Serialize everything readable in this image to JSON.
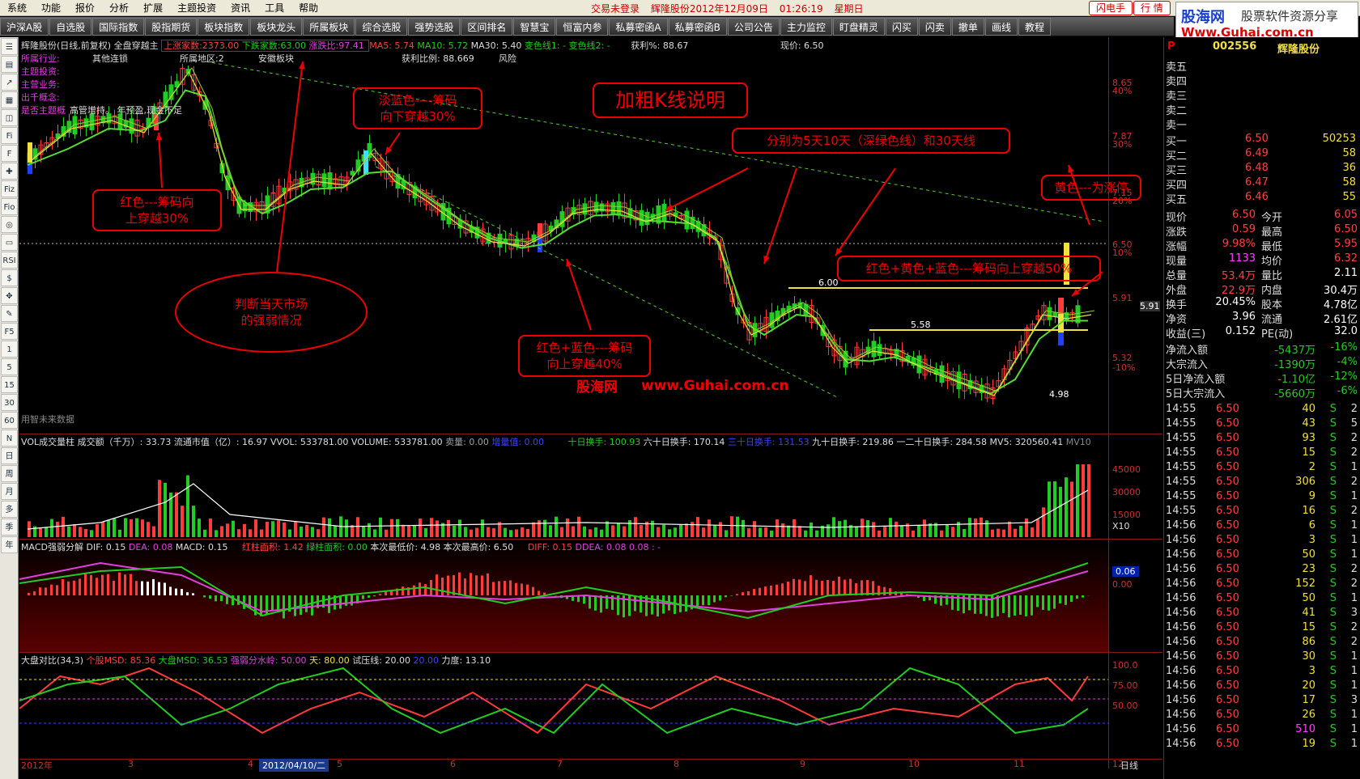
{
  "menu": {
    "items": [
      "系统",
      "功能",
      "报价",
      "分析",
      "扩展",
      "主题投资",
      "资讯",
      "工具",
      "帮助"
    ],
    "status": [
      "交易未登录",
      "辉隆股份2012年12月09日",
      "01:26:19",
      "星期日"
    ],
    "btn_flash": "闪电手",
    "btn_quote": "行 情"
  },
  "logo": {
    "line1a": "股海网",
    "line1b": "股票软件资源分享",
    "line2": "Www.Guhai.com.cn"
  },
  "toolbar": [
    "沪深A股",
    "自选股",
    "国际指数",
    "股指期货",
    "板块指数",
    "板块龙头",
    "所属板块",
    "综合选股",
    "强势选股",
    "区间排名",
    "智慧宝",
    "恒富内参",
    "私募密函A",
    "私募密函B",
    "公司公告",
    "主力监控",
    "盯盘精灵",
    "闪买",
    "闪卖",
    "撤单",
    "画线",
    "教程"
  ],
  "leftbar": [
    "☰",
    "▤",
    "↗",
    "▦",
    "◫",
    "Fi",
    "F",
    "✚",
    "Fiz",
    "Fio",
    "◎",
    "▭",
    "RSI",
    "$",
    "✥",
    "✎",
    "F5",
    "1",
    "5",
    "15",
    "30",
    "60",
    "N",
    "日",
    "周",
    "月",
    "多",
    "季",
    "年"
  ],
  "main_header": {
    "name": "辉隆股份(日线,前复权)",
    "indicator": "全盘穿越主",
    "up_count": "上涨家数:2373.00",
    "down_count": "下跌家数:63.00",
    "ratio": "涨跌比:97.41",
    "ma5": "MA5: 5.74",
    "ma10": "MA10: 5.72",
    "ma30": "MA30: 5.40",
    "varline": "变色线1: -",
    "varline2": "变色线2: -",
    "profit": "获利%: 88.67",
    "price": "现价: 6.50",
    "profit_ratio": "获利比例: 88.669",
    "risk": "风险"
  },
  "info_lines": [
    {
      "k": "所属行业:",
      "v": "其他连锁",
      "k2": "所属地区:2",
      "v2": "安徽板块"
    },
    {
      "k": "主题投资:",
      "v": ""
    },
    {
      "k": "主营业务:",
      "v": ""
    },
    {
      "k": "出千概念:",
      "v": ""
    },
    {
      "k": "是否主题概",
      "v": "高管增持。    年预盈,现金不足"
    }
  ],
  "watermark": "用智未来数据",
  "annotations": {
    "a1": "红色---筹码向\n上穿越30%",
    "a2": "淡蓝色----筹码\n向下穿越30%",
    "a3": "判断当天市场\n的强弱情况",
    "a4": "加粗K线说明",
    "a5": "分别为5天10天（深绿色线）和30天线",
    "a6": "黄色---为涨停",
    "a7": "红色+黄色+蓝色---筹码向上穿越50%",
    "a8": "红色+蓝色---筹码\n向上穿越40%",
    "brand1": "股海网",
    "brand2": "www.Guhai.com.cn"
  },
  "price_labels": {
    "p600": "6.00",
    "p558": "5.58",
    "p498": "4.98",
    "p591": "5.91"
  },
  "price_axis": [
    "8.65",
    "40%",
    "7.87",
    "30%",
    "7.15",
    "20%",
    "6.50",
    "10%",
    "5.91",
    "5.32",
    "-10%"
  ],
  "vol_header": {
    "title": "VOL成交量柱",
    "amount": "成交额（千万）: 33.73",
    "mcap": "流通市值（亿）: 16.97",
    "vvol": "VVOL: 533781.00",
    "volume": "VOLUME: 533781.00",
    "sell": "卖量: 0.00",
    "buy": "增量值: 0.00",
    "t10": "十日换手: 100.93",
    "t60": "六十日换手: 170.14",
    "t30": "三十日换手: 131.53",
    "t90": "九十日换手: 219.86",
    "t120": "一二十日换手: 284.58",
    "mv5": "MV5: 320560.41",
    "mv10": "MV10"
  },
  "vol_axis": [
    "45000",
    "30000",
    "15000",
    "X10"
  ],
  "macd_header": {
    "title": "MACD强弱分解",
    "dif": "DIF: 0.15",
    "dea": "DEA: 0.08",
    "macd": "MACD: 0.15",
    "red": "红柱面积: 1.42",
    "green": "绿柱面积: 0.00",
    "low": "本次最低价: 4.98",
    "high": "本次最高价: 6.50",
    "diff": "DIFF: 0.15",
    "ddea": "DDEA: 0.08",
    "ddea2": "0.08 : -"
  },
  "macd_axis": [
    "0.06",
    "0.00"
  ],
  "msd_header": {
    "title": "大盘对比(34,3)",
    "stock": "个股MSD: 85.36",
    "market": "大盘MSD: 36.53",
    "water": "强弱分水岭: 50.00",
    "sky": "天: 80.00",
    "test": "试压线: 20.00",
    "v20": "20.00",
    "force": "力度: 13.10"
  },
  "msd_axis": [
    "100.0",
    "75.00",
    "50.00"
  ],
  "date_axis": [
    "2012年",
    "3",
    "4",
    "2012/04/10/二",
    "5",
    "6",
    "7",
    "8",
    "9",
    "10",
    "11",
    "12",
    "日线"
  ],
  "rpanel": {
    "code": "002556",
    "name": "辉隆股份",
    "asks": [
      "卖五",
      "卖四",
      "卖三",
      "卖二",
      "卖一"
    ],
    "bids": [
      {
        "l": "买一",
        "p": "6.50",
        "v": "50253"
      },
      {
        "l": "买二",
        "p": "6.49",
        "v": "58"
      },
      {
        "l": "买三",
        "p": "6.48",
        "v": "36"
      },
      {
        "l": "买四",
        "p": "6.47",
        "v": "58"
      },
      {
        "l": "买五",
        "p": "6.46",
        "v": "55"
      }
    ],
    "stats": [
      {
        "a": "现价",
        "b": "6.50",
        "c": "今开",
        "d": "6.05"
      },
      {
        "a": "涨跌",
        "b": "0.59",
        "c": "最高",
        "d": "6.50"
      },
      {
        "a": "涨幅",
        "b": "9.98%",
        "c": "最低",
        "d": "5.95"
      },
      {
        "a": "现量",
        "b": "1133",
        "c": "均价",
        "d": "6.32"
      },
      {
        "a": "总量",
        "b": "53.4万",
        "c": "量比",
        "d": "2.11"
      },
      {
        "a": "外盘",
        "b": "22.9万",
        "c": "内盘",
        "d": "30.4万"
      },
      {
        "a": "换手",
        "b": "20.45%",
        "c": "股本",
        "d": "4.78亿"
      },
      {
        "a": "净资",
        "b": "3.96",
        "c": "流通",
        "d": "2.61亿"
      },
      {
        "a": "收益(三)",
        "b": "0.152",
        "c": "PE(动)",
        "d": "32.0"
      }
    ],
    "flows": [
      {
        "a": "净流入额",
        "b": "-5437万",
        "c": "-16%"
      },
      {
        "a": "大宗流入",
        "b": "-1390万",
        "c": "-4%"
      },
      {
        "a": "5日净流入额",
        "b": "-1.10亿",
        "c": "-12%"
      },
      {
        "a": "5日大宗流入",
        "b": "-5660万",
        "c": "-6%"
      }
    ],
    "ticks": [
      {
        "t": "14:55",
        "p": "6.50",
        "v": "40",
        "s": "S",
        "n": "2"
      },
      {
        "t": "14:55",
        "p": "6.50",
        "v": "43",
        "s": "S",
        "n": "5"
      },
      {
        "t": "14:55",
        "p": "6.50",
        "v": "93",
        "s": "S",
        "n": "2"
      },
      {
        "t": "14:55",
        "p": "6.50",
        "v": "15",
        "s": "S",
        "n": "2"
      },
      {
        "t": "14:55",
        "p": "6.50",
        "v": "2",
        "s": "S",
        "n": "1"
      },
      {
        "t": "14:55",
        "p": "6.50",
        "v": "306",
        "s": "S",
        "n": "2"
      },
      {
        "t": "14:55",
        "p": "6.50",
        "v": "9",
        "s": "S",
        "n": "1"
      },
      {
        "t": "14:55",
        "p": "6.50",
        "v": "16",
        "s": "S",
        "n": "2"
      },
      {
        "t": "14:56",
        "p": "6.50",
        "v": "6",
        "s": "S",
        "n": "1"
      },
      {
        "t": "14:56",
        "p": "6.50",
        "v": "3",
        "s": "S",
        "n": "1"
      },
      {
        "t": "14:56",
        "p": "6.50",
        "v": "50",
        "s": "S",
        "n": "1"
      },
      {
        "t": "14:56",
        "p": "6.50",
        "v": "23",
        "s": "S",
        "n": "2"
      },
      {
        "t": "14:56",
        "p": "6.50",
        "v": "152",
        "s": "S",
        "n": "2"
      },
      {
        "t": "14:56",
        "p": "6.50",
        "v": "50",
        "s": "S",
        "n": "1"
      },
      {
        "t": "14:56",
        "p": "6.50",
        "v": "41",
        "s": "S",
        "n": "3"
      },
      {
        "t": "14:56",
        "p": "6.50",
        "v": "15",
        "s": "S",
        "n": "2"
      },
      {
        "t": "14:56",
        "p": "6.50",
        "v": "86",
        "s": "S",
        "n": "2"
      },
      {
        "t": "14:56",
        "p": "6.50",
        "v": "30",
        "s": "S",
        "n": "1"
      },
      {
        "t": "14:56",
        "p": "6.50",
        "v": "3",
        "s": "S",
        "n": "1"
      },
      {
        "t": "14:56",
        "p": "6.50",
        "v": "20",
        "s": "S",
        "n": "1"
      },
      {
        "t": "14:56",
        "p": "6.50",
        "v": "17",
        "s": "S",
        "n": "3"
      },
      {
        "t": "14:56",
        "p": "6.50",
        "v": "26",
        "s": "S",
        "n": "1"
      },
      {
        "t": "14:56",
        "p": "6.50",
        "v": "510",
        "s": "S",
        "n": "1"
      },
      {
        "t": "14:56",
        "p": "6.50",
        "v": "19",
        "s": "S",
        "n": "1"
      }
    ]
  },
  "colors": {
    "red": "#ff3b3b",
    "green": "#22cc22",
    "yellow": "#f0e040",
    "cyan": "#40e0ff",
    "magenta": "#e040e0",
    "panel_border": "#8a1a1a"
  }
}
